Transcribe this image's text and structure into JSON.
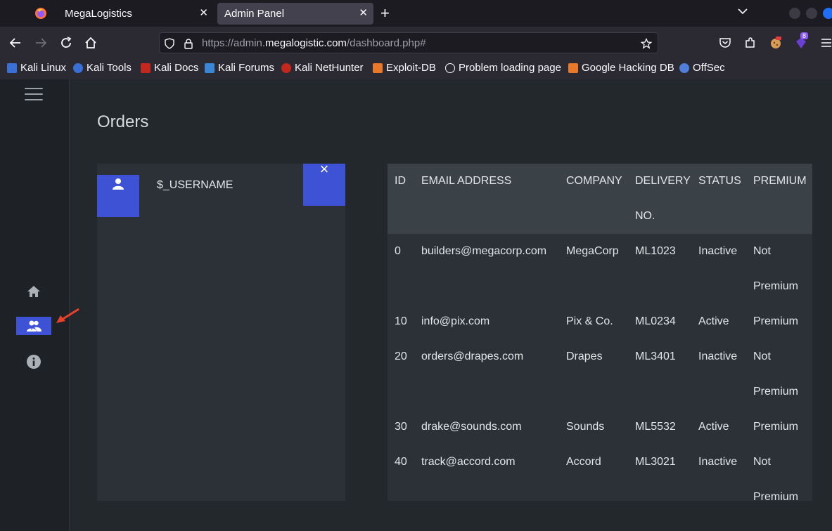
{
  "browser": {
    "tabs": [
      {
        "title": "MegaLogistics",
        "active": false
      },
      {
        "title": "Admin Panel",
        "active": true
      }
    ],
    "url": {
      "prefix": "https://admin.",
      "host": "megalogistic.com",
      "path": "/dashboard.php#"
    },
    "extension_badge": "8",
    "bookmarks": [
      {
        "label": "Kali Linux",
        "icon": "kali-icon"
      },
      {
        "label": "Kali Tools",
        "icon": "kali-tools-icon"
      },
      {
        "label": "Kali Docs",
        "icon": "kali-docs-icon"
      },
      {
        "label": "Kali Forums",
        "icon": "kali-forums-icon"
      },
      {
        "label": "Kali NetHunter",
        "icon": "nethunter-icon"
      },
      {
        "label": "Exploit-DB",
        "icon": "exploit-db-icon"
      },
      {
        "label": "Problem loading page",
        "icon": "globe-icon"
      },
      {
        "label": "Google Hacking DB",
        "icon": "ghdb-icon"
      },
      {
        "label": "OffSec",
        "icon": "offsec-icon"
      }
    ]
  },
  "page": {
    "title": "Orders",
    "user_card": {
      "username": "$_USERNAME",
      "close": "×"
    },
    "sidebar": {
      "items": [
        "home-icon",
        "users-icon",
        "info-icon"
      ],
      "active": "users-icon"
    },
    "table": {
      "headers": [
        "ID",
        "EMAIL ADDRESS",
        "COMPANY",
        "DELIVERY NO.",
        "STATUS",
        "PREMIUM"
      ],
      "rows": [
        [
          "0",
          "builders@megacorp.com",
          "MegaCorp",
          "ML1023",
          "Inactive",
          "Not Premium"
        ],
        [
          "10",
          "info@pix.com",
          "Pix & Co.",
          "ML0234",
          "Active",
          "Premium"
        ],
        [
          "20",
          "orders@drapes.com",
          "Drapes",
          "ML3401",
          "Inactive",
          "Not Premium"
        ],
        [
          "30",
          "drake@sounds.com",
          "Sounds",
          "ML5532",
          "Active",
          "Premium"
        ],
        [
          "40",
          "track@accord.com",
          "Accord",
          "ML3021",
          "Inactive",
          "Not Premium"
        ]
      ]
    }
  },
  "colors": {
    "accent": "#3d52d5",
    "annotation_arrow": "#e8402a"
  }
}
